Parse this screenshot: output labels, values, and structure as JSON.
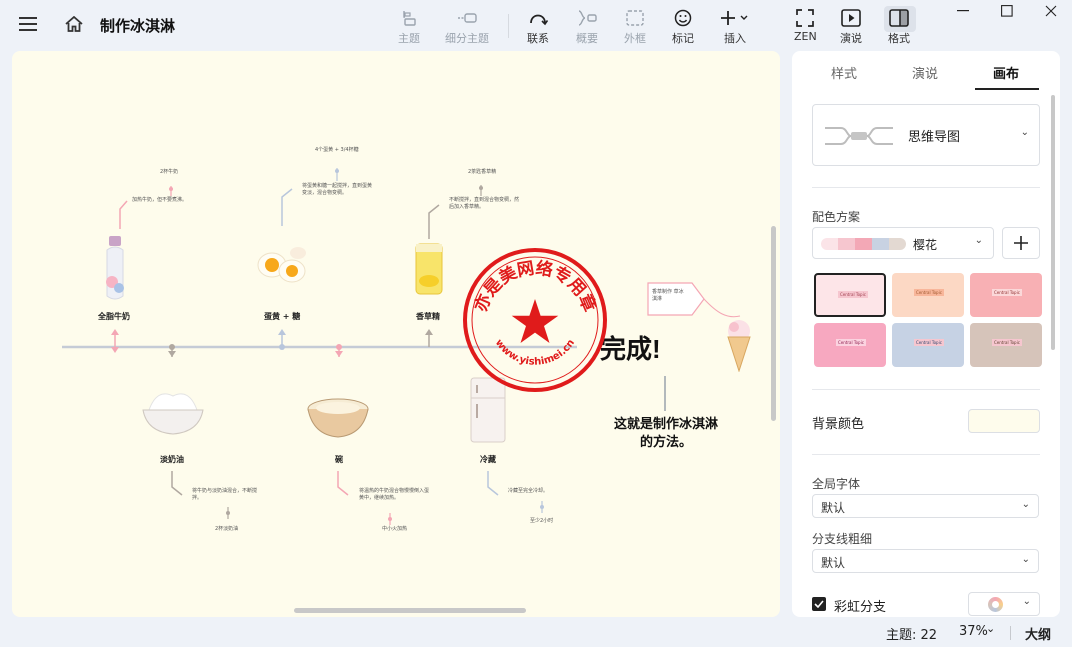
{
  "title": "制作冰淇淋",
  "toolbar": {
    "topic": "主题",
    "subtopic": "细分主题",
    "relation": "联系",
    "summary": "概要",
    "boundary": "外框",
    "marker": "标记",
    "insert": "插入",
    "zen": "ZEN",
    "present": "演说",
    "format": "格式"
  },
  "panel": {
    "tabs": [
      "样式",
      "演说",
      "画布"
    ],
    "structure": "思维导图",
    "color_scheme_label": "配色方案",
    "color_scheme": "樱花",
    "bg_color_label": "背景颜色",
    "font_label": "全局字体",
    "font_value": "默认",
    "branch_width_label": "分支线粗细",
    "branch_width_value": "默认",
    "rainbow_label": "彩虹分支",
    "theme_thumb_text": "Central Topic"
  },
  "mindmap": {
    "topics": [
      "全脂牛奶",
      "蛋黄 + 糖",
      "香草精",
      "淡奶油",
      "碗",
      "冷藏"
    ],
    "notes": {
      "milk_tag": "2杯牛奶",
      "milk_note": "加热牛奶，但不要煮沸。",
      "egg_tag": "4个蛋黄 + 3/4杯糖",
      "egg_note": "将蛋黄和糖一起搅拌，直到蛋黄变淡，混合物变稠。",
      "vanilla_tag": "2茶匙香草精",
      "vanilla_note": "不断搅拌，直到混合物变稠，然后加入香草精。",
      "cream_note": "将牛奶与淡奶油混合，不断搅拌。",
      "cream_tag": "2杯淡奶油",
      "bowl_note": "将温热的牛奶混合物慢慢倒入蛋黄中，继续加热。",
      "bowl_tag": "中小火加热",
      "fridge_note": "冷藏至完全冷却。",
      "fridge_tag": "至少2小时"
    },
    "label_tag": "香草制作 草冰淇淋",
    "done": "完成!",
    "done_sub": "这就是制作冰淇淋的方法。"
  },
  "watermark": {
    "text": "亦是美网络专用章",
    "url": "www.yishimei.cn"
  },
  "status": {
    "topics": "主题: 22",
    "zoom": "37%",
    "outline": "大纲"
  },
  "colors": {
    "canvas_bg": "#fefcec",
    "accent_pink": "#f4a6b4",
    "accent_blue": "#b8c6dc",
    "stamp_red": "#e01b1b"
  }
}
